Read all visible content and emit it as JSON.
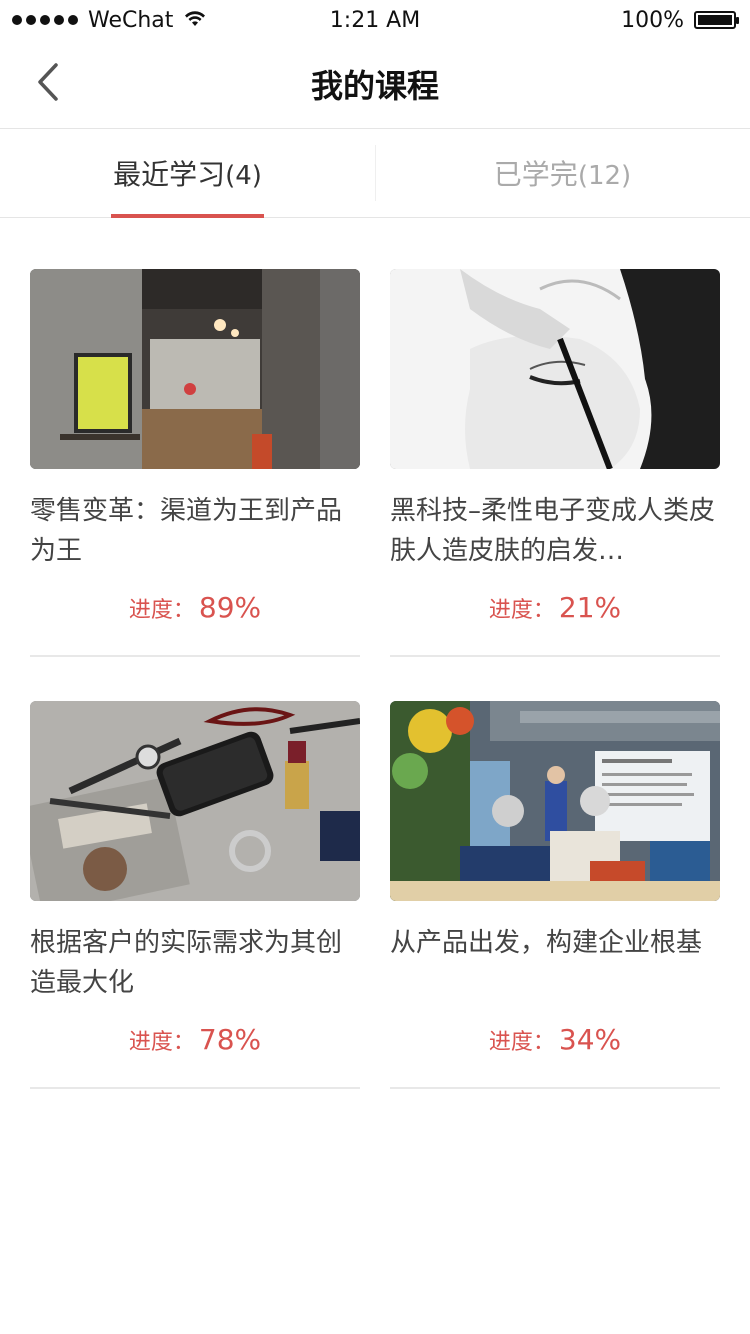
{
  "status_bar": {
    "carrier": "WeChat",
    "time": "1:21 AM",
    "battery": "100%"
  },
  "nav": {
    "title": "我的课程",
    "back_icon": "chevron-left-icon"
  },
  "tabs": [
    {
      "label": "最近学习",
      "count": "(4)",
      "active": true
    },
    {
      "label": "已学完",
      "count": "(12)",
      "active": false
    }
  ],
  "courses": [
    {
      "title": "零售变革：渠道为王到产品为王",
      "progress_label": "进度：",
      "progress": "89%",
      "progress_value": 0.89
    },
    {
      "title": "黑科技–柔性电子变成人类皮肤人造皮肤的启发…",
      "progress_label": "进度：",
      "progress": "21%",
      "progress_value": 0.21
    },
    {
      "title": "根据客户的实际需求为其创造最大化",
      "progress_label": "进度：",
      "progress": "78%",
      "progress_value": 0.78
    },
    {
      "title": "从产品出发，构建企业根基",
      "progress_label": "进度：",
      "progress": "34%",
      "progress_value": 0.34
    }
  ],
  "colors": {
    "accent": "#d9534f",
    "divider": "#e5e5e5"
  }
}
